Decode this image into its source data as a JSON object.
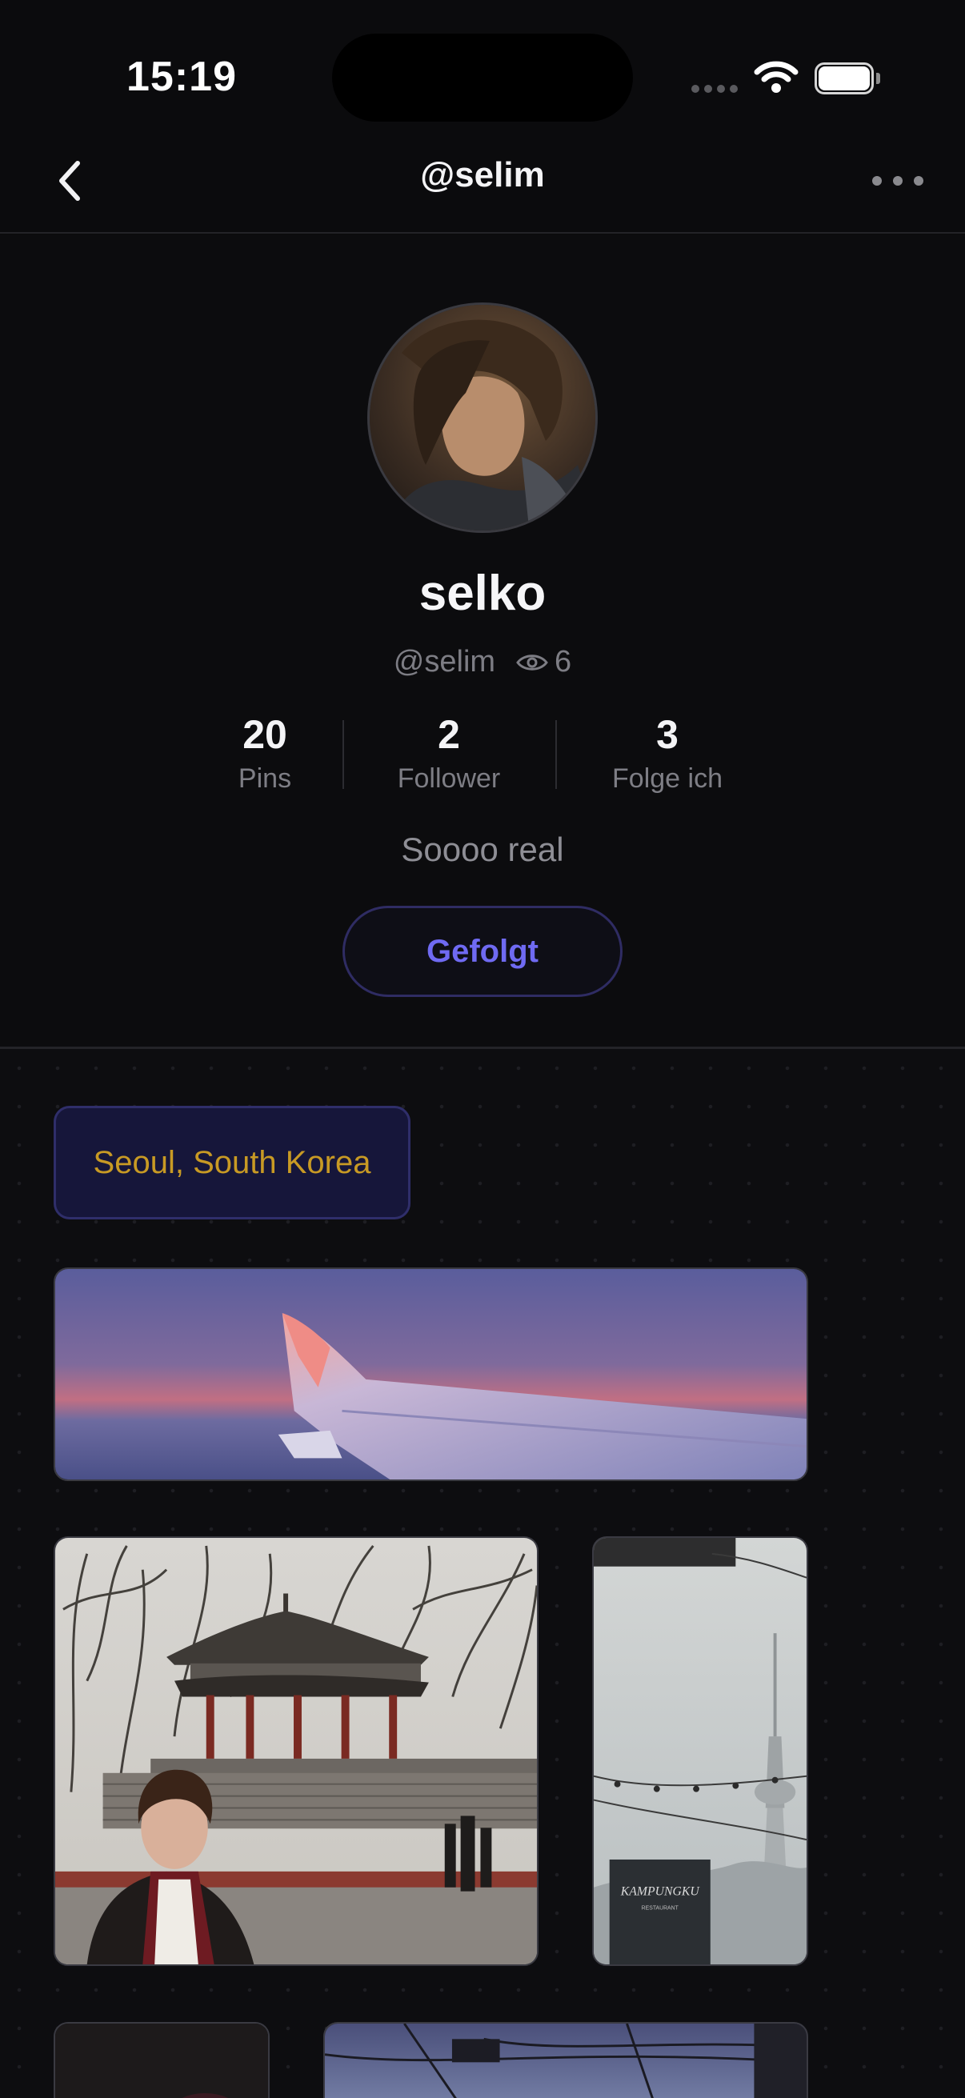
{
  "status_bar": {
    "time": "15:19"
  },
  "nav": {
    "title": "@selim"
  },
  "profile": {
    "display_name": "selko",
    "handle": "@selim",
    "views": "6",
    "stats": [
      {
        "value": "20",
        "label": "Pins"
      },
      {
        "value": "2",
        "label": "Follower"
      },
      {
        "value": "3",
        "label": "Folge ich"
      }
    ],
    "bio": "Soooo real",
    "follow_label": "Gefolgt"
  },
  "board": {
    "location": "Seoul, South Korea",
    "pins": [
      {
        "name": "pin-airplane-wing"
      },
      {
        "name": "pin-pavilion-portrait"
      },
      {
        "name": "pin-seoul-tower",
        "sign_text": "KAMPUNGKU",
        "sign_subtext": "RESTAURANT"
      },
      {
        "name": "pin-dark-photo"
      },
      {
        "name": "pin-street-wires"
      }
    ]
  },
  "colors": {
    "background": "#0b0b0d",
    "accent": "#6f6af2",
    "location_text": "#c89a24",
    "chip_bg": "#16163a"
  }
}
